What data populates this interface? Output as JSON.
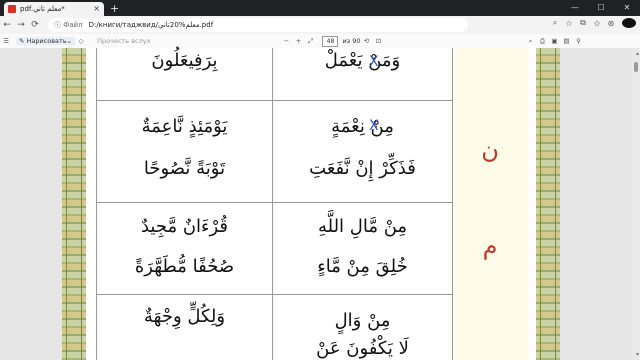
{
  "browser": {
    "tab_title": "pdf.معلم تاني*",
    "tab_close": "×",
    "new_tab": "+",
    "win_min": "—",
    "win_max": "☐",
    "win_close": "✕",
    "back": "←",
    "forward": "→",
    "reload": "⟳",
    "addr_label": "ⓘ Файл",
    "url": "D:/книги/таджвид/معلم%20تاني.pdf",
    "zoom_icon": "⌕",
    "star_icon": "☆",
    "split_icon": "⧉",
    "fav_icon": "✩",
    "profile_icon": "⊛"
  },
  "pdf_toolbar": {
    "contents_icon": "☰",
    "draw_label": "Нарисовать",
    "erase_icon": "◇",
    "read_aloud": "Прочесть вслух",
    "zoom_out": "−",
    "zoom_in": "+",
    "fit_icon": "⤢",
    "page": "48",
    "of_pages": "из 90",
    "rotate_icon": "⟲",
    "view_icon": "⊡",
    "search_icon": "⌕",
    "print_icon": "⎙",
    "save_icon": "▣",
    "save_as_icon": "▤",
    "pin_icon": "⚲",
    "scroll_up": "▴",
    "scroll_down": "▾"
  },
  "rows": [
    {
      "right": "بِرَفِيعَلُونَ",
      "mid": "وَمَنْ يَعْمَلْ",
      "letter": ""
    },
    {
      "right1": "يَوْمَئِذٍ نَّاعِمَةٌ",
      "right2": "تَوْبَةً نَّصُوحًا",
      "mid1": "مِنْ نِعْمَةٍ",
      "mid2": "فَذَكِّرْ إِنْ نَّفَعَتِ",
      "letter": "ن"
    },
    {
      "right1": "قُرْءَانٌ مَّجِيدٌ",
      "right2": "صُحُفًا مُّطَهَّرَةً",
      "mid1": "مِنْ مَّالِ اللَّهِ",
      "mid2": "خُلِقَ مِنْ مَّاءٍ",
      "letter": "م"
    },
    {
      "right1": "وَلِكُلٍّ وِجْهَةٌ",
      "right2": "",
      "mid1": "مِنْ وَالٍ",
      "mid2": "لَا يَكْفُونَ عَنْ",
      "letter": ""
    }
  ],
  "xmark": "X"
}
